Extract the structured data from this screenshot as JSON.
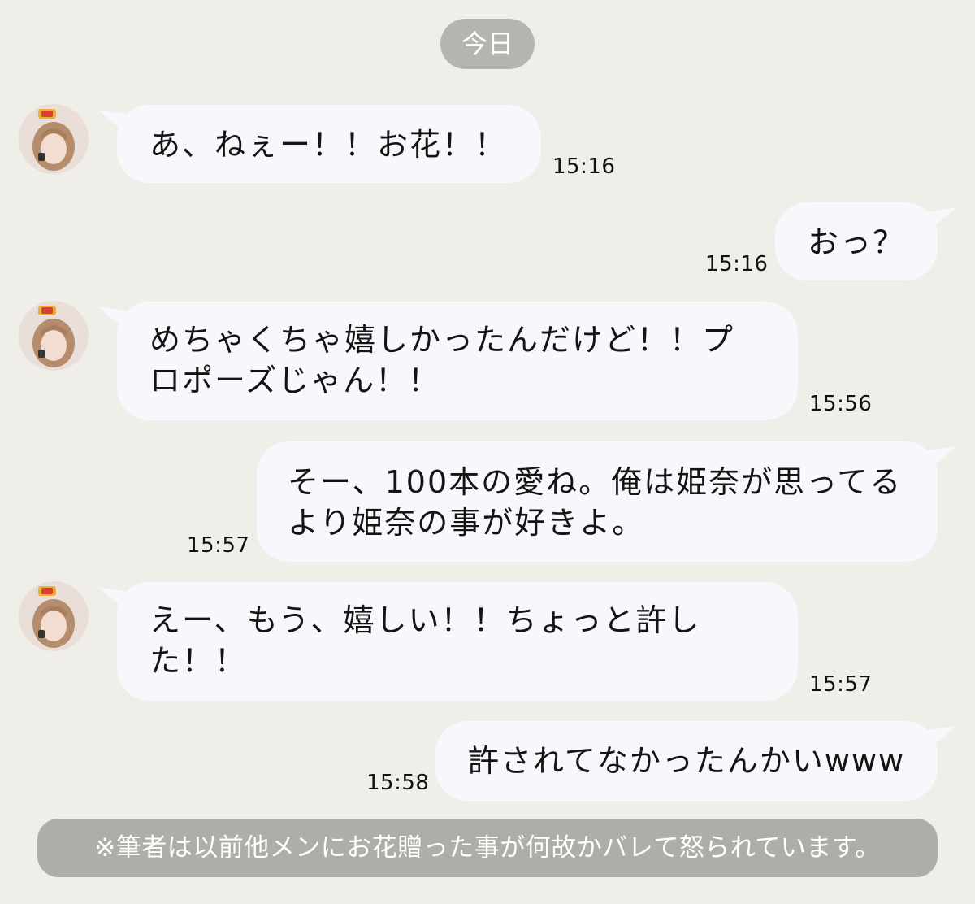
{
  "chat": {
    "date_label": "今日",
    "messages": [
      {
        "side": "left",
        "text_lines": [
          "あ、ねぇー！！お花！！"
        ],
        "time": "15:16"
      },
      {
        "side": "right",
        "text_lines": [
          "おっ？"
        ],
        "time": "15:16"
      },
      {
        "side": "left",
        "text_lines": [
          "めちゃくちゃ嬉しかったんだけど！！プ",
          "ロポーズじゃん！！"
        ],
        "time": "15:56"
      },
      {
        "side": "right",
        "text_lines": [
          "そー、100本の愛ね。俺は姫奈が思ってる",
          "より姫奈の事が好きよ。"
        ],
        "time": "15:57"
      },
      {
        "side": "left",
        "text_lines": [
          "えー、もう、嬉しい！！ちょっと許し",
          "た！！"
        ],
        "time": "15:57"
      },
      {
        "side": "right",
        "text_lines": [
          "許されてなかったんかいwww"
        ],
        "time": "15:58"
      }
    ],
    "footer_note": "※筆者は以前他メンにお花贈った事が何故かバレて怒られています。"
  },
  "colors": {
    "background": "#efeee8",
    "bubble": "#f8f8fc",
    "pill": "#b3b5af",
    "note": "#acaea8"
  }
}
